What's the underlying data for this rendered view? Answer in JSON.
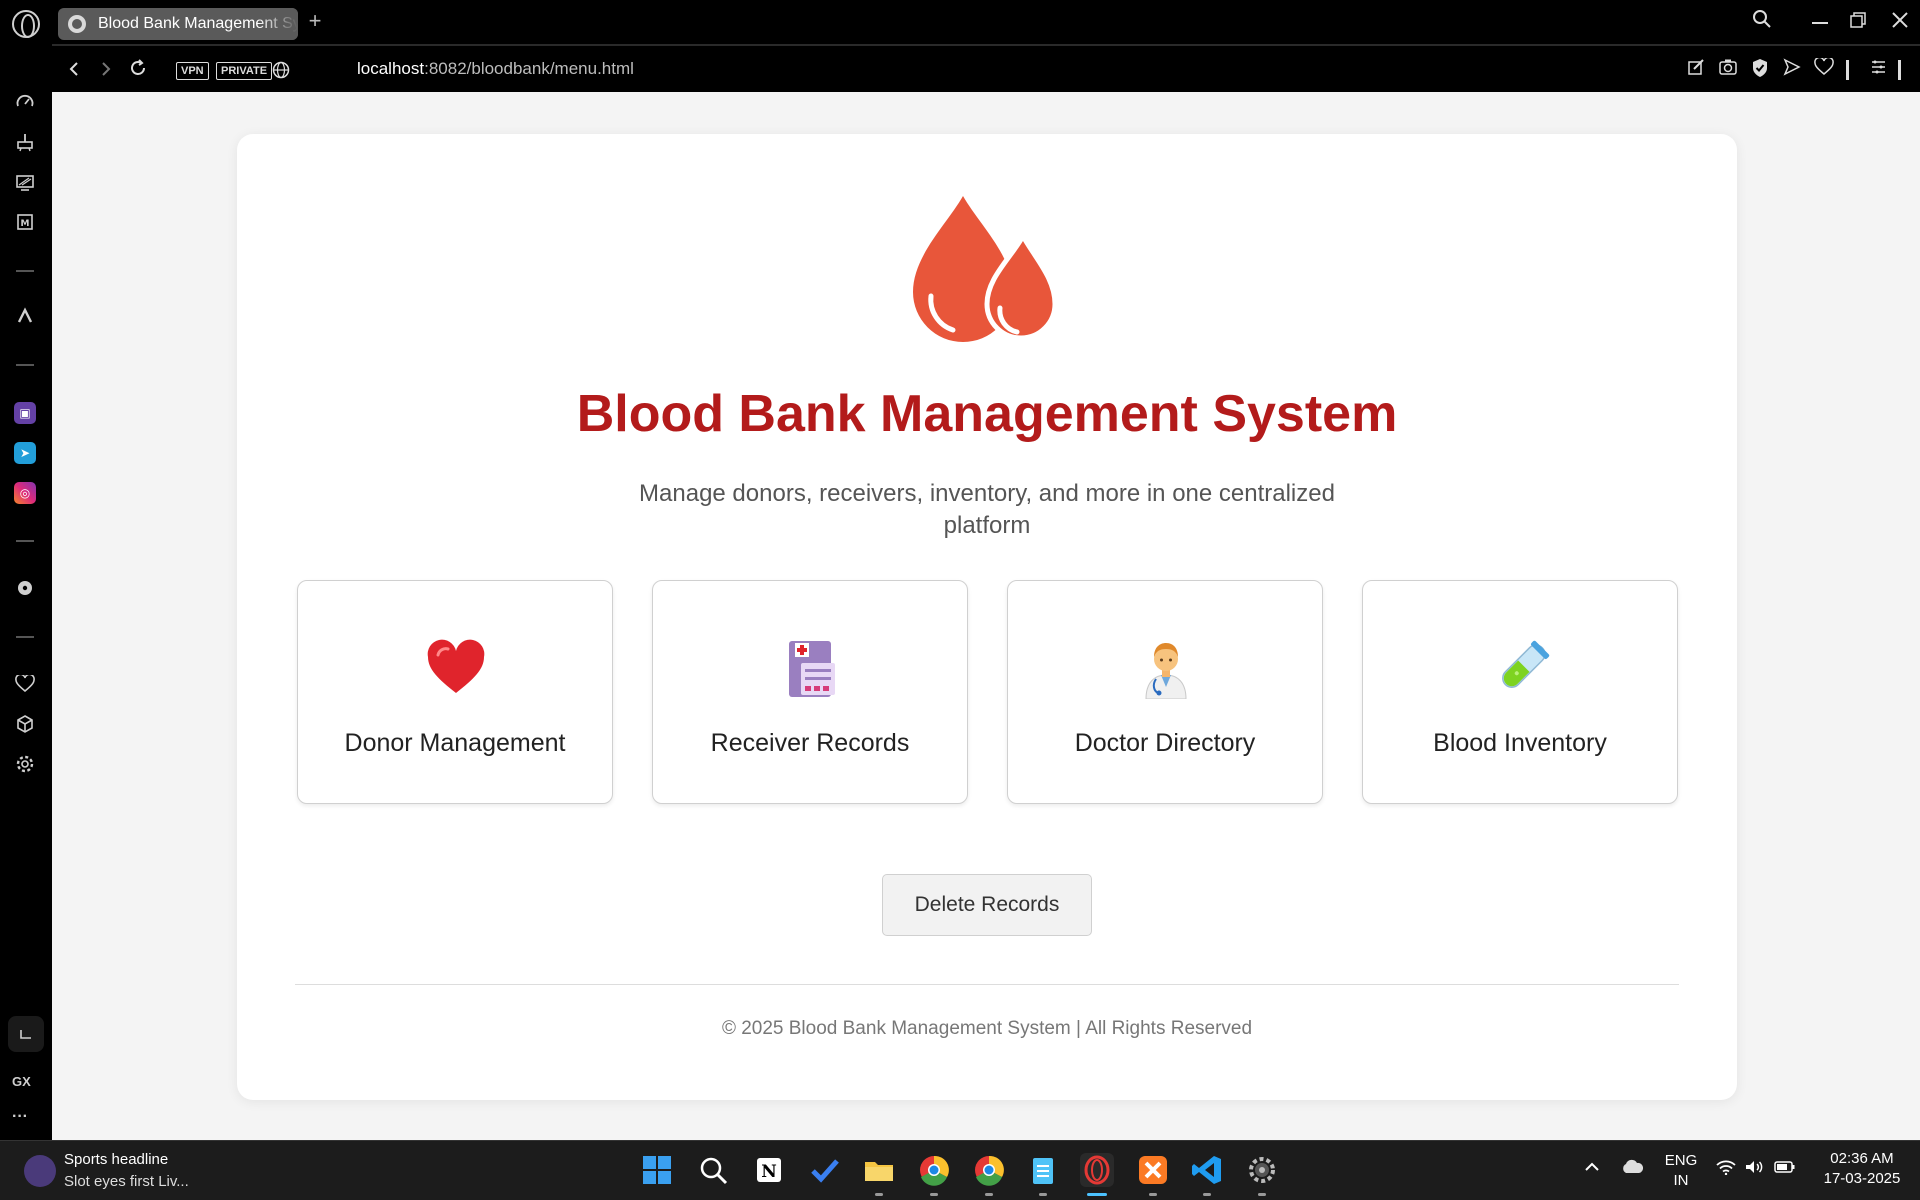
{
  "browser": {
    "tab_title": "Blood Bank Management System",
    "new_tab_symbol": "+",
    "vpn_label": "VPN",
    "private_label": "PRIVATE",
    "url_host": "localhost",
    "url_rest": ":8082/bloodbank/menu.html"
  },
  "page": {
    "title": "Blood Bank Management System",
    "subtitle": "Manage donors, receivers, inventory, and more in one centralized platform",
    "features": [
      {
        "label": "Donor Management",
        "icon": "heart-icon"
      },
      {
        "label": "Receiver Records",
        "icon": "medical-record-icon"
      },
      {
        "label": "Doctor Directory",
        "icon": "doctor-icon"
      },
      {
        "label": "Blood Inventory",
        "icon": "test-tube-icon"
      }
    ],
    "delete_button": "Delete Records",
    "footer": "© 2025 Blood Bank Management System | All Rights Reserved"
  },
  "sidebar": {
    "gx_label": "GX",
    "more_label": "···"
  },
  "taskbar": {
    "news_title": "Sports headline",
    "news_sub": "Slot eyes first Liv...",
    "lang_top": "ENG",
    "lang_bottom": "IN",
    "time": "02:36 AM",
    "date": "17-03-2025"
  },
  "colors": {
    "title": "#b31b1b",
    "drop": "#e8563a",
    "browser_bg": "#000000",
    "page_bg": "#f4f4f4"
  }
}
